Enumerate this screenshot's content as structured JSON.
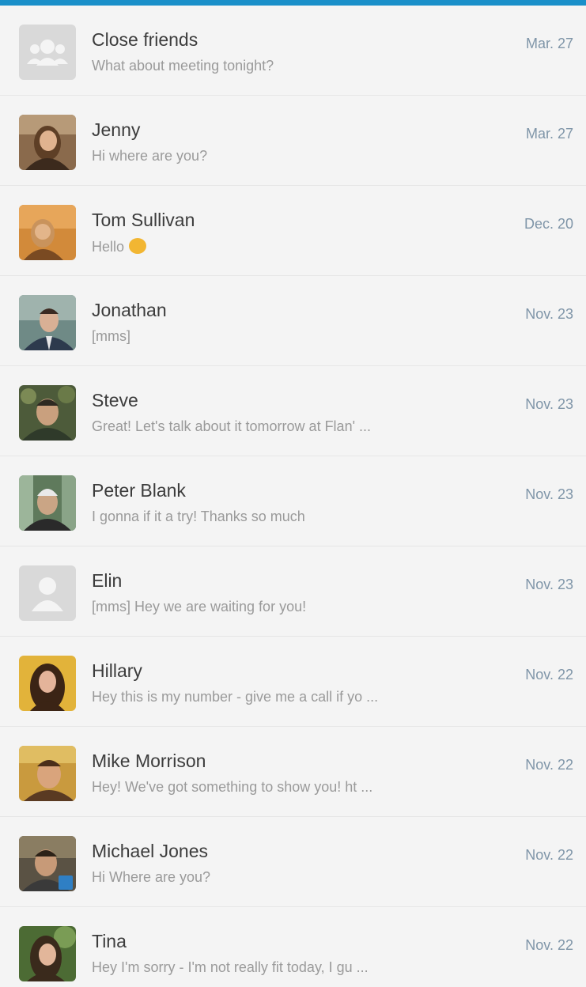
{
  "threads": [
    {
      "name": "Close friends",
      "preview": "What about meeting tonight?",
      "date": "Mar. 27",
      "avatar": "group-icon"
    },
    {
      "name": "Jenny",
      "preview": "Hi where are you?",
      "date": "Mar. 27",
      "avatar": "photo"
    },
    {
      "name": "Tom Sullivan",
      "preview": "Hello",
      "date": "Dec. 20",
      "avatar": "photo",
      "emoji": "smiley-emoji"
    },
    {
      "name": "Jonathan",
      "preview": "[mms]",
      "date": "Nov. 23",
      "avatar": "photo"
    },
    {
      "name": "Steve",
      "preview": "Great! Let's talk about it tomorrow at Flan' ...",
      "date": "Nov. 23",
      "avatar": "photo"
    },
    {
      "name": "Peter Blank",
      "preview": "I gonna if it a try! Thanks so much",
      "date": "Nov. 23",
      "avatar": "photo"
    },
    {
      "name": "Elin",
      "preview": "[mms] Hey we are waiting for you!",
      "date": "Nov. 23",
      "avatar": "person-icon"
    },
    {
      "name": "Hillary",
      "preview": "Hey this is my number - give me a call if yo ...",
      "date": "Nov. 22",
      "avatar": "photo"
    },
    {
      "name": "Mike Morrison",
      "preview": "Hey! We've got something to show you! ht ...",
      "date": "Nov. 22",
      "avatar": "photo"
    },
    {
      "name": "Michael Jones",
      "preview": "Hi Where are you?",
      "date": "Nov. 22",
      "avatar": "photo"
    },
    {
      "name": "Tina",
      "preview": "Hey I'm sorry - I'm not really fit today, I gu ...",
      "date": "Nov. 22",
      "avatar": "photo"
    }
  ],
  "colors": {
    "accent": "#1a8fc9",
    "name_text": "#3c3c3c",
    "preview_text": "#9a9a9a",
    "date_text": "#7f95a8",
    "row_background": "#f4f4f4",
    "placeholder_avatar": "#d9d9d9"
  }
}
